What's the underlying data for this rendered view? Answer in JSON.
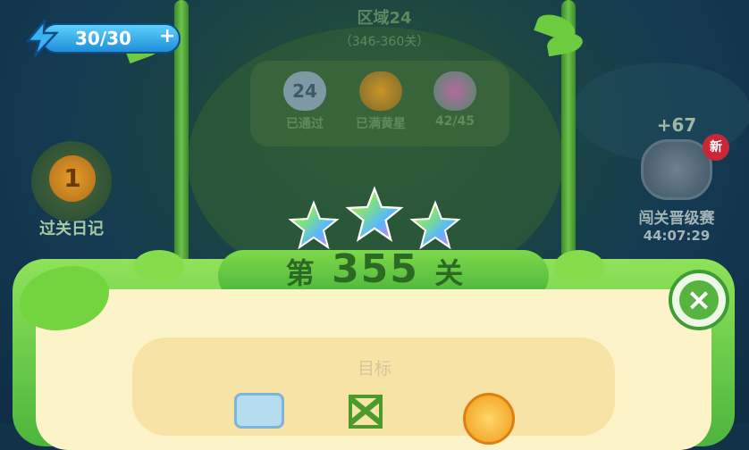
{
  "energy": {
    "value": "30/30",
    "plus": "+"
  },
  "region": {
    "title": "区域24",
    "range": "（346-360关）"
  },
  "region_stats": [
    {
      "icon": "cloud-badge-icon",
      "badge": "24",
      "label": "已通过"
    },
    {
      "icon": "gold-star-icon",
      "badge": "",
      "label": "已满黄星"
    },
    {
      "icon": "rainbow-star-icon",
      "badge": "",
      "label": "42/45"
    }
  ],
  "left_side": {
    "badge": "1",
    "label": "过关日记"
  },
  "right_side": {
    "bonus": "+67",
    "new_badge": "新",
    "label": "闯关晋级赛",
    "timer": "44:07:29"
  },
  "level": {
    "prefix": "第",
    "number": "355",
    "suffix": "关"
  },
  "goal": {
    "title": "目标"
  },
  "close_label": "×",
  "colors": {
    "board_green": "#6ccb3f",
    "cream": "#fdf3c8",
    "energy_blue": "#2aa3ec",
    "level_text": "#2a6a23"
  }
}
